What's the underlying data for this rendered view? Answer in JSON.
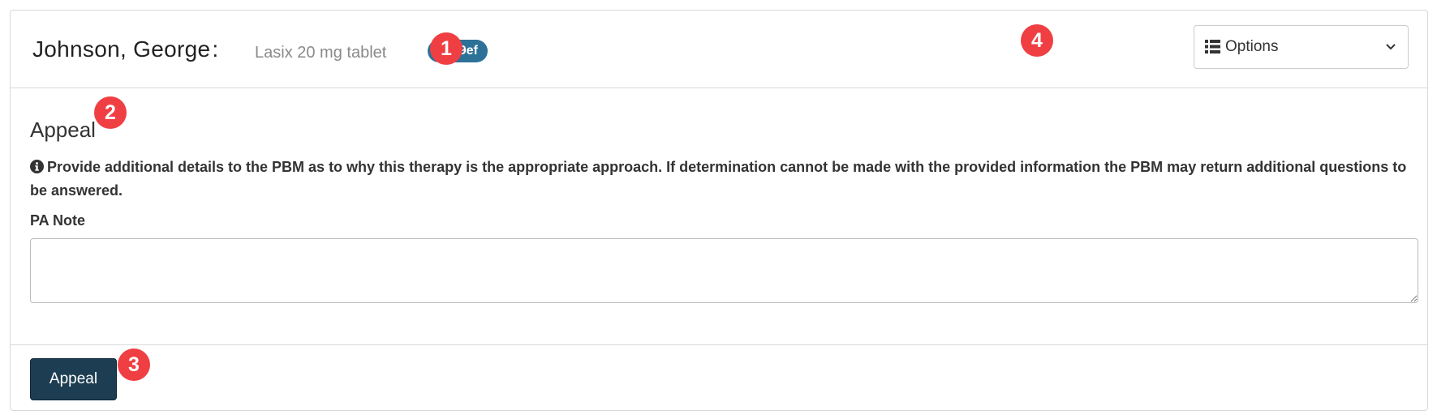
{
  "header": {
    "patient_name": "Johnson, George",
    "colon": ":",
    "drug": "Lasix 20 mg tablet",
    "rx_id": "4909ef",
    "options": {
      "icon": "list-icon",
      "label": "Options",
      "dropdown_icon": "chevron-down-icon"
    }
  },
  "section": {
    "title": "Appeal",
    "help_icon": "info-circle-icon",
    "help_text": "Provide additional details to the PBM as to why this therapy is the appropriate approach. If determination cannot be made with the provided information the PBM may return additional questions to be answered."
  },
  "form": {
    "pa_note_label": "PA Note",
    "pa_note_value": "",
    "pa_note_placeholder": ""
  },
  "footer": {
    "appeal_button_label": "Appeal"
  },
  "annotations": [
    {
      "label": "1"
    },
    {
      "label": "2"
    },
    {
      "label": "3"
    },
    {
      "label": "4"
    }
  ],
  "colors": {
    "badge": "#2d7198",
    "primary_button": "#1d3d52",
    "marker": "#ef3f43",
    "border": "#d8d8d8",
    "text": "#333333"
  }
}
